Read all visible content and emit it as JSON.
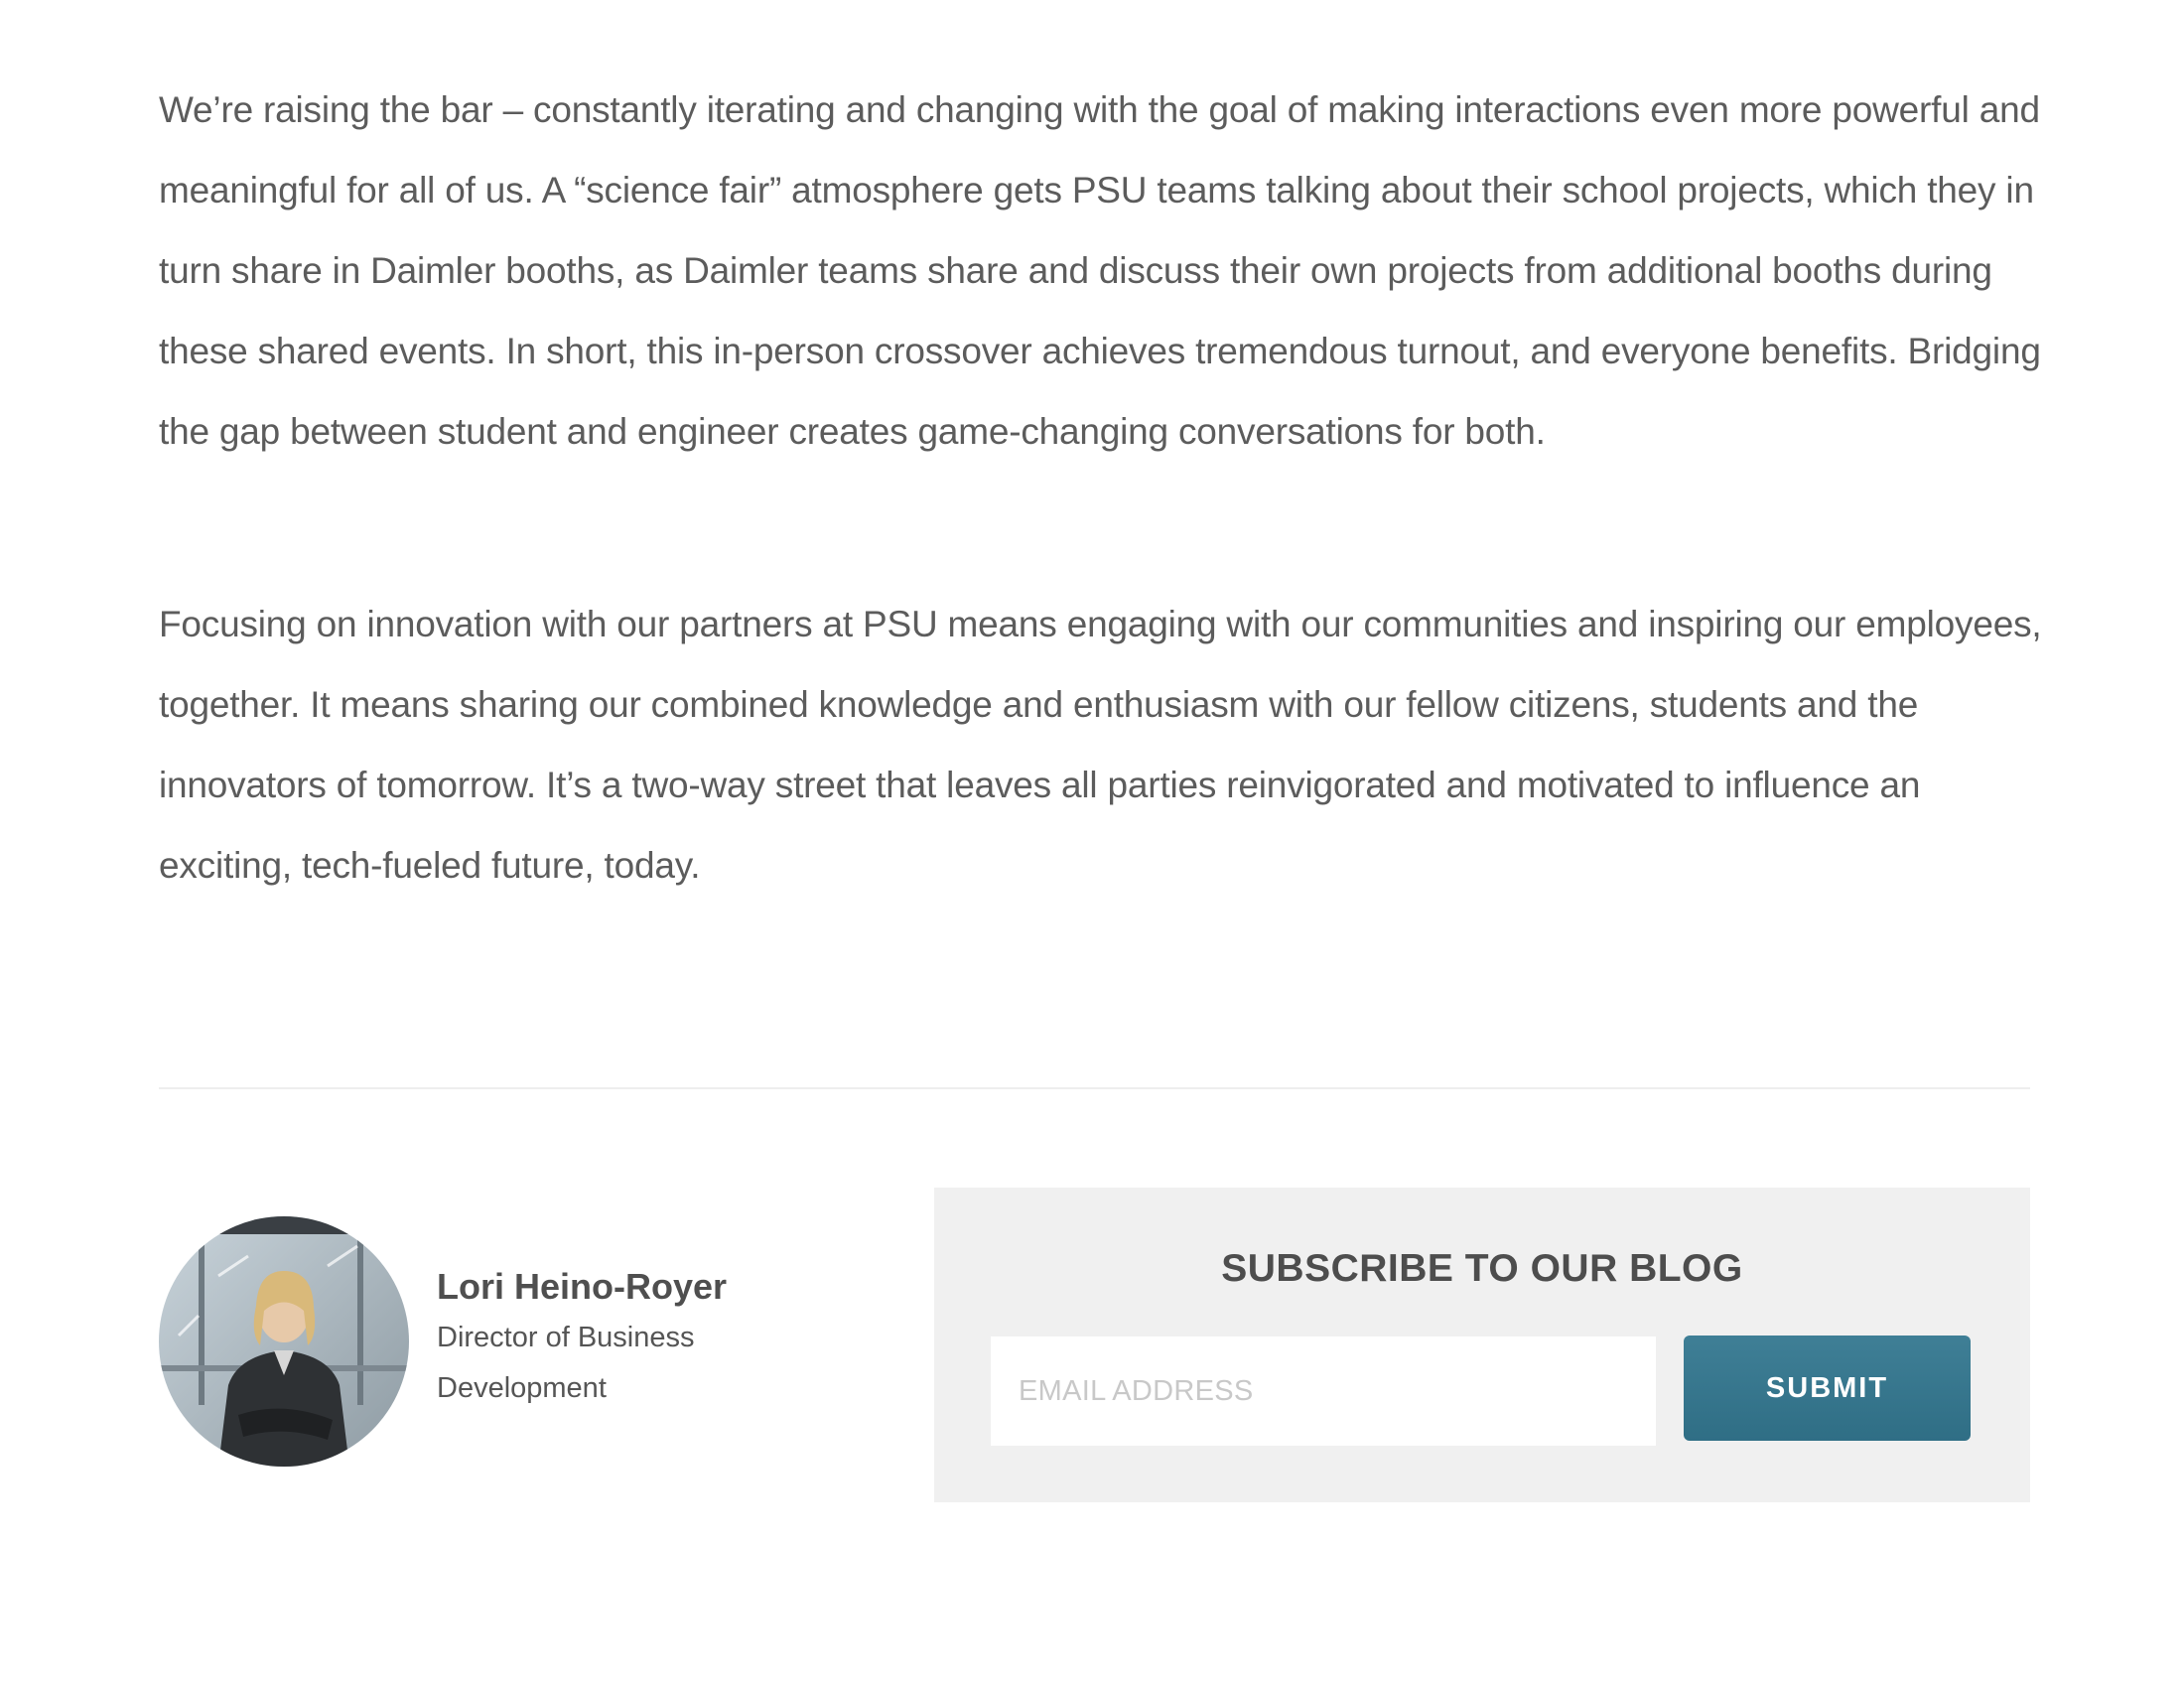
{
  "article": {
    "paragraphs": [
      "We’re raising the bar – constantly iterating and changing with the goal of making interactions even more powerful and meaningful for all of us. A “science fair” atmosphere gets PSU teams talking about their school projects, which they in turn share in Daimler booths, as Daimler teams share and discuss their own projects from additional booths during these shared events. In short, this in-person crossover achieves tremendous turnout, and everyone benefits. Bridging the gap between student and engineer creates game-changing conversations for both.",
      "Focusing on innovation with our partners at PSU means engaging with our communities and inspiring our employees, together. It means sharing our combined knowledge and enthusiasm with our fellow citizens, students and the innovators of tomorrow. It’s a two-way street that leaves all parties reinvigorated and motivated to influence an exciting, tech-fueled future, today."
    ]
  },
  "author": {
    "name": "Lori Heino-Royer",
    "role": "Director of Business Development",
    "avatar_icon": "person-photo"
  },
  "subscribe": {
    "title": "SUBSCRIBE TO OUR BLOG",
    "email_placeholder": "EMAIL ADDRESS",
    "email_value": "",
    "submit_label": "SUBMIT"
  },
  "colors": {
    "body_text": "#5c5c5c",
    "panel_background": "#f0f0f0",
    "button": "#35738a",
    "divider": "#eeeeee"
  }
}
